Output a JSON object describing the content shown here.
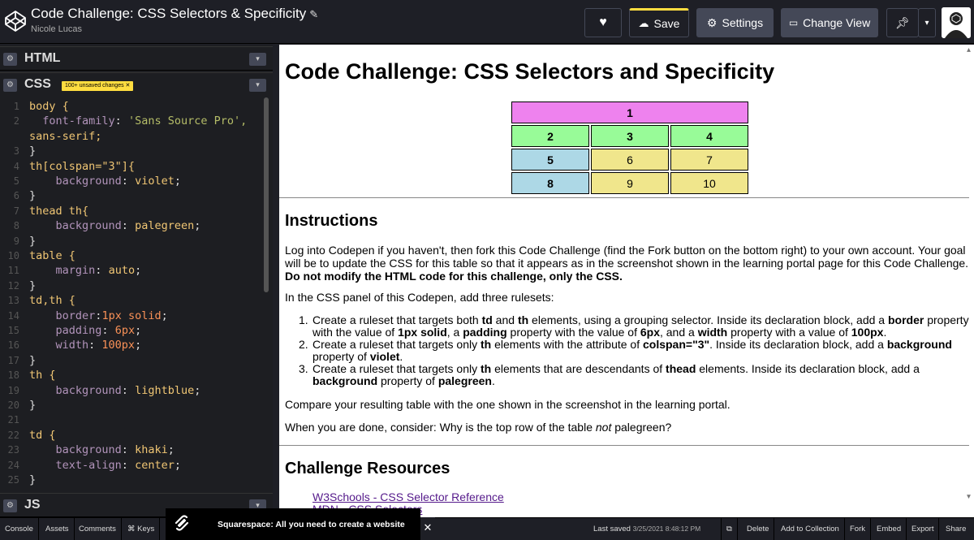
{
  "header": {
    "title": "Code Challenge: CSS Selectors & Specificity",
    "author": "Nicole Lucas",
    "save_label": "Save",
    "settings_label": "Settings",
    "change_view_label": "Change View"
  },
  "panes": {
    "html_label": "HTML",
    "css_label": "CSS",
    "css_badge": "100+ unsaved changes",
    "js_label": "JS"
  },
  "css_lines": [
    "body {",
    "  font-family: 'Sans Source Pro',",
    "sans-serif;",
    "}",
    "th[colspan=\"3\"]{",
    "    background: violet;",
    "}",
    "thead th{",
    "    background: palegreen;",
    "}",
    "table {",
    "    margin: auto;",
    "}",
    "td,th {",
    "    border:1px solid;",
    "    padding: 6px;",
    "    width: 100px;",
    "}",
    "th {",
    "    background: lightblue;",
    "}",
    "",
    "td {",
    "    background: khaki;",
    "    text-align: center;",
    "}"
  ],
  "css_line_numbers": [
    "1",
    "2",
    "",
    "3",
    "4",
    "5",
    "6",
    "7",
    "8",
    "9",
    "10",
    "11",
    "12",
    "13",
    "14",
    "15",
    "16",
    "17",
    "18",
    "19",
    "20",
    "21",
    "22",
    "23",
    "24",
    "25"
  ],
  "preview": {
    "h1": "Code Challenge: CSS Selectors and Specificity",
    "table": {
      "row1": [
        "1"
      ],
      "row2": [
        "2",
        "3",
        "4"
      ],
      "row3": [
        "5",
        "6",
        "7"
      ],
      "row4": [
        "8",
        "9",
        "10"
      ]
    },
    "instructions_heading": "Instructions",
    "intro_text": "Log into Codepen if you haven't, then fork this Code Challenge (find the Fork button on the bottom right) to your own account. Your goal will be to update the CSS for this table so that it appears as in the screenshot shown in the learning portal page for this Code Challenge.",
    "intro_bold": "Do not modify the HTML code for this challenge, only the CSS.",
    "panel_text": "In the CSS panel of this Codepen, add three rulesets:",
    "list": [
      {
        "num": "1.",
        "parts": [
          "Create a ruleset that targets both ",
          "td",
          " and ",
          "th",
          " elements, using a grouping selector. Inside its declaration block, add a ",
          "border",
          " property with the value of ",
          "1px solid",
          ", a ",
          "padding",
          " property with the value of ",
          "6px",
          ", and a ",
          "width",
          " property with a value of ",
          "100px",
          "."
        ]
      },
      {
        "num": "2.",
        "parts": [
          "Create a ruleset that targets only ",
          "th",
          " elements with the attribute of ",
          "colspan=\"3\"",
          ". Inside its declaration block, add a ",
          "background",
          " property of ",
          "violet",
          "."
        ]
      },
      {
        "num": "3.",
        "parts": [
          "Create a ruleset that targets only ",
          "th",
          " elements that are descendants of ",
          "thead",
          " elements. Inside its declaration block, add a ",
          "background",
          " property of ",
          "palegreen",
          "."
        ]
      }
    ],
    "compare_text": "Compare your resulting table with the one shown in the screenshot in the learning portal.",
    "done_text_1": "When you are done, consider: Why is the top row of the table ",
    "done_text_em": "not",
    "done_text_2": " palegreen?",
    "resources_heading": "Challenge Resources",
    "links": [
      "W3Schools - CSS Selector Reference",
      "MDN - CSS Selectors"
    ]
  },
  "bottom": {
    "console": "Console",
    "assets": "Assets",
    "comments": "Comments",
    "keys": "⌘ Keys",
    "ad_text": "Squarespace: All you need to create a website",
    "last_saved_label": "Last saved",
    "last_saved_time": "3/25/2021 8:48:12 PM",
    "delete": "Delete",
    "add_to_collection": "Add to Collection",
    "fork": "Fork",
    "embed": "Embed",
    "export": "Export",
    "share": "Share"
  },
  "colors": {
    "violet": "#ee82ee",
    "palegreen": "#98fb98",
    "lightblue": "#add8e6",
    "khaki": "#f0e68c",
    "save_accent": "#ffdd40"
  }
}
